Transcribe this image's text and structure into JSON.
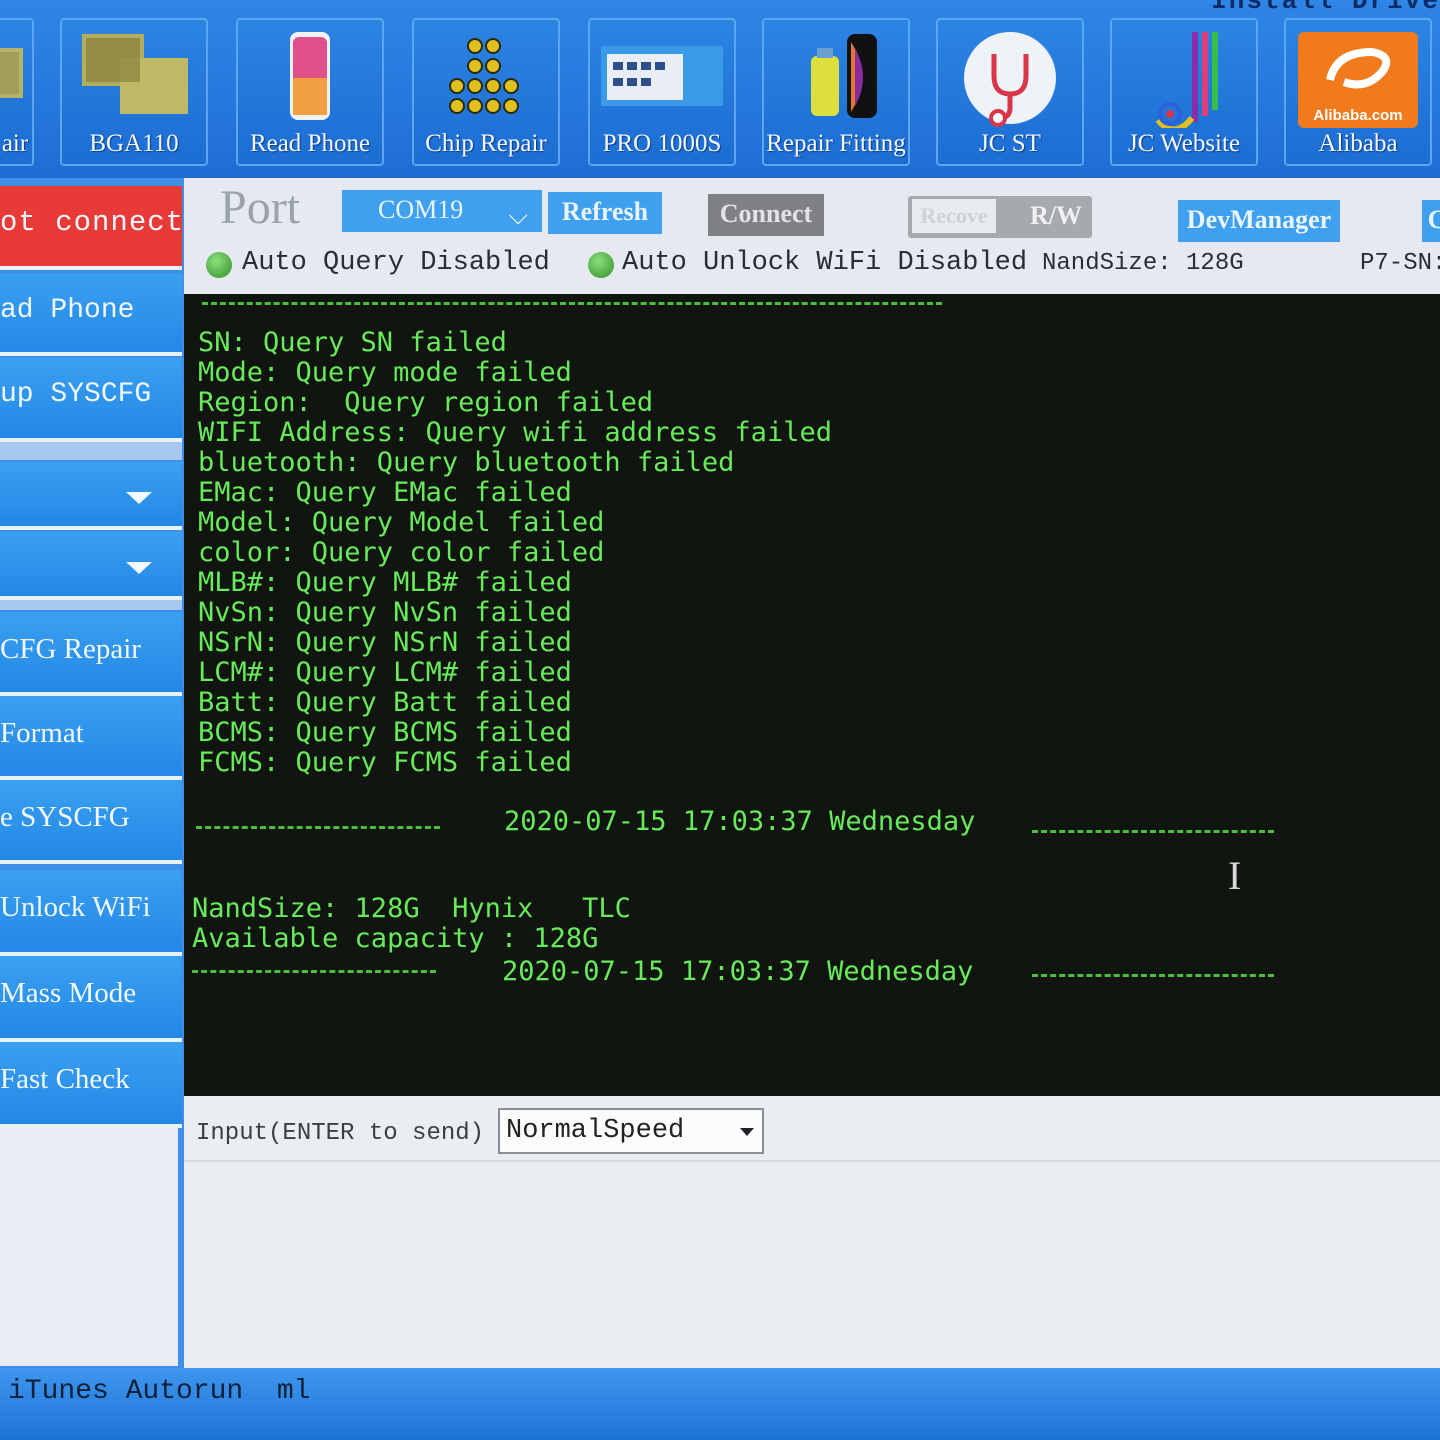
{
  "toolbar": {
    "title_partial": "Install Drive",
    "tools": [
      {
        "label": "air",
        "icon": "bga-chip-icon"
      },
      {
        "label": "BGA110",
        "icon": "bga-chip-icon"
      },
      {
        "label": "Read Phone",
        "icon": "phone-icon"
      },
      {
        "label": "Chip Repair",
        "icon": "chip-icon"
      },
      {
        "label": "PRO 1000S",
        "icon": "programmer-device-icon"
      },
      {
        "label": "Repair Fitting",
        "icon": "repair-fitting-icon"
      },
      {
        "label": "JC ST",
        "icon": "stethoscope-icon"
      },
      {
        "label": "JC Website",
        "icon": "jc-logo-icon"
      },
      {
        "label": "Alibaba",
        "icon": "alibaba-logo-icon",
        "logo_text": "Alibaba.com"
      }
    ]
  },
  "sidebar": {
    "status": "ot connecte",
    "items": [
      "ad Phone",
      "up SYSCFG",
      "",
      "",
      "CFG Repair",
      "Format",
      "e SYSCFG",
      "Unlock WiFi",
      "Mass Mode",
      "Fast Check"
    ]
  },
  "port": {
    "label": "Port",
    "selected": "COM19",
    "refresh": "Refresh",
    "connect": "Connect",
    "recovery": "Recove",
    "rw": "R/W",
    "devmanager": "DevManager"
  },
  "status_row": {
    "auto_query": "Auto Query Disabled",
    "auto_unlock": "Auto Unlock WiFi Disabled",
    "nandsize": "NandSize: 128G",
    "p7sn": "P7-SN:"
  },
  "console": {
    "lines": [
      "SN: Query SN failed",
      "Mode: Query mode failed",
      "Region:  Query region failed",
      "WIFI Address: Query wifi address failed",
      "bluetooth: Query bluetooth failed",
      "EMac: Query EMac failed",
      "Model: Query Model failed",
      "color: Query color failed",
      "MLB#: Query MLB# failed",
      "NvSn: Query NvSn failed",
      "NSrN: Query NSrN failed",
      "LCM#: Query LCM# failed",
      "Batt: Query Batt failed",
      "BCMS: Query BCMS failed",
      "FCMS: Query FCMS failed"
    ],
    "timestamp1": "2020-07-15 17:03:37 Wednesday",
    "nand_info": "NandSize: 128G  Hynix   TLC",
    "capacity": "Available capacity : 128G",
    "timestamp2": "2020-07-15 17:03:37 Wednesday",
    "text_color": "#68ea5a",
    "background": "#101510"
  },
  "input": {
    "label": "Input(ENTER to send)",
    "speed": "NormalSpeed"
  },
  "bottom_bar": {
    "text": "iTunes Autorun  ml"
  },
  "colors": {
    "toolbar_blue": "#2f86e6",
    "sidebar_blue": "#2388e6",
    "not_connected_red": "#e83a36"
  }
}
